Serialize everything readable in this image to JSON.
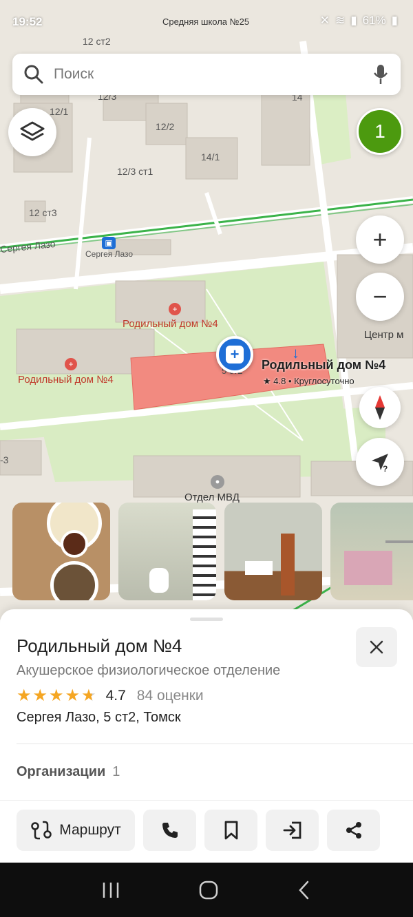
{
  "status_bar": {
    "time": "19:52",
    "nearby": "Средняя школа №25",
    "battery": "61%"
  },
  "search": {
    "placeholder": "Поиск"
  },
  "map": {
    "cluster_count": "1",
    "labels": {
      "b12st2": "12 ст2",
      "b12_3": "12/3",
      "b12_1": "12/1",
      "b12_2": "12/2",
      "b14": "14",
      "b14_1": "14/1",
      "b12_3st1": "12/3 ст1",
      "b12st3": "12 ст3",
      "street": "Сергея Лазо",
      "stop": "Сергея Лазо",
      "poi_red_1": "Родильный дом №4",
      "poi_red_2": "Родильный дом №4",
      "center": "Центр м",
      "police": "Отдел МВД",
      "house_num": "5 ст2",
      "corner": "-3"
    },
    "selected_poi": {
      "name": "Родильный дом №4",
      "rating": "★ 4.8 • Круглосуточно"
    }
  },
  "place": {
    "title": "Родильный дом №4",
    "subtitle": "Акушерское физиологическое отделение",
    "rating_value": "4.7",
    "stars": 4.7,
    "rating_count": "84 оценки",
    "address": "Сергея Лазо, 5 ст2, Томск",
    "organizations_label": "Организации",
    "organizations_count": "1"
  },
  "actions": {
    "route": "Маршрут"
  },
  "colors": {
    "accent_green": "#4c9a0f",
    "pin_blue": "#1e6ed6",
    "star": "#f5a623"
  }
}
